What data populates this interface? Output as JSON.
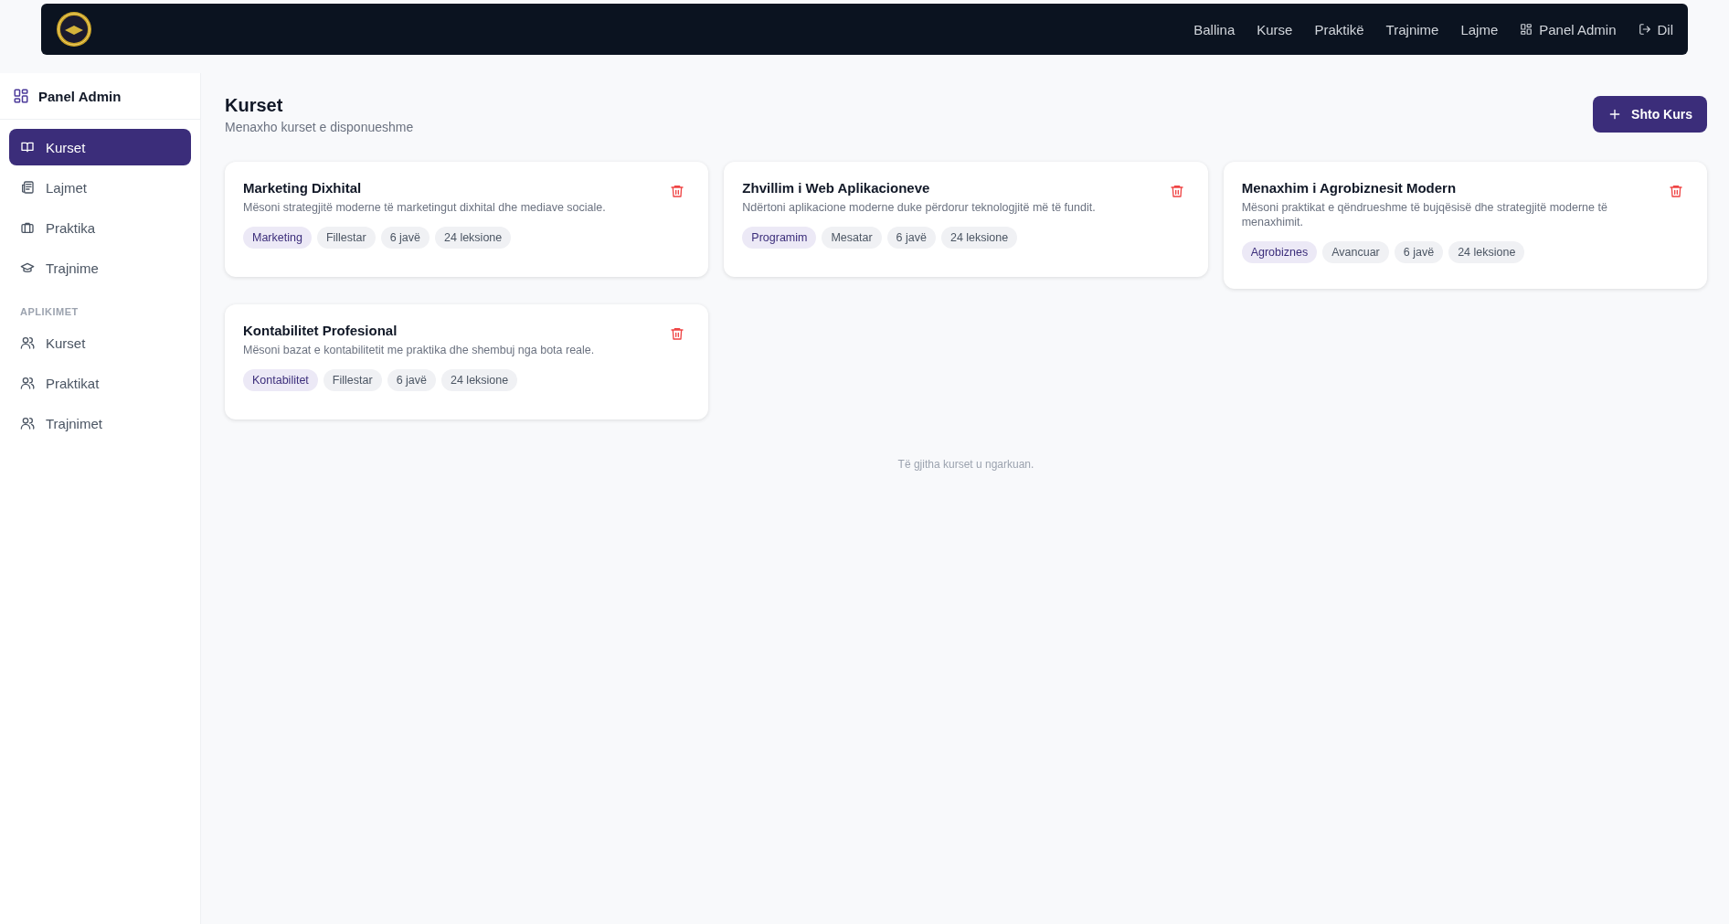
{
  "navbar": {
    "links": [
      {
        "label": "Ballina",
        "kind": "text"
      },
      {
        "label": "Kurse",
        "kind": "text"
      },
      {
        "label": "Praktikë",
        "kind": "text"
      },
      {
        "label": "Trajnime",
        "kind": "text"
      },
      {
        "label": "Lajme",
        "kind": "text"
      },
      {
        "label": "Panel Admin",
        "kind": "admin"
      },
      {
        "label": "Dil",
        "kind": "logout"
      }
    ]
  },
  "sidebar": {
    "title": "Panel Admin",
    "items": [
      {
        "label": "Kurset",
        "kind": "book",
        "selected": true
      },
      {
        "label": "Lajmet",
        "kind": "news",
        "selected": false
      },
      {
        "label": "Praktika",
        "kind": "briefcase",
        "selected": false
      },
      {
        "label": "Trajnime",
        "kind": "cap",
        "selected": false
      }
    ],
    "section": "APLIKIMET",
    "applications": [
      {
        "label": "Kurset",
        "kind": "users",
        "selected": false
      },
      {
        "label": "Praktikat",
        "kind": "users",
        "selected": false
      },
      {
        "label": "Trajnimet",
        "kind": "users",
        "selected": false
      }
    ]
  },
  "page": {
    "title": "Kurset",
    "subtitle": "Menaxho kurset e disponueshme",
    "add_button": "Shto Kurs"
  },
  "courses": [
    {
      "title": "Marketing Dixhital",
      "description": "Mësoni strategjitë moderne të marketingut dixhital dhe mediave sociale.",
      "tags": [
        {
          "label": "Marketing",
          "kind": "category"
        },
        {
          "label": "Fillestar",
          "kind": "plain"
        },
        {
          "label": "6 javë",
          "kind": "plain"
        },
        {
          "label": "24 leksione",
          "kind": "plain"
        }
      ]
    },
    {
      "title": "Zhvillim i Web Aplikacioneve",
      "description": "Ndërtoni aplikacione moderne duke përdorur teknologjitë më të fundit.",
      "tags": [
        {
          "label": "Programim",
          "kind": "category"
        },
        {
          "label": "Mesatar",
          "kind": "plain"
        },
        {
          "label": "6 javë",
          "kind": "plain"
        },
        {
          "label": "24 leksione",
          "kind": "plain"
        }
      ]
    },
    {
      "title": "Menaxhim i Agrobiznesit Modern",
      "description": "Mësoni praktikat e qëndrueshme të bujqësisë dhe strategjitë moderne të menaxhimit.",
      "tags": [
        {
          "label": "Agrobiznes",
          "kind": "category"
        },
        {
          "label": "Avancuar",
          "kind": "plain"
        },
        {
          "label": "6 javë",
          "kind": "plain"
        },
        {
          "label": "24 leksione",
          "kind": "plain"
        }
      ]
    },
    {
      "title": "Kontabilitet Profesional",
      "description": "Mësoni bazat e kontabilitetit me praktika dhe shembuj nga bota reale.",
      "tags": [
        {
          "label": "Kontabilitet",
          "kind": "category"
        },
        {
          "label": "Fillestar",
          "kind": "plain"
        },
        {
          "label": "6 javë",
          "kind": "plain"
        },
        {
          "label": "24 leksione",
          "kind": "plain"
        }
      ]
    }
  ],
  "footer_note": "Të gjitha kurset u ngarkuan."
}
